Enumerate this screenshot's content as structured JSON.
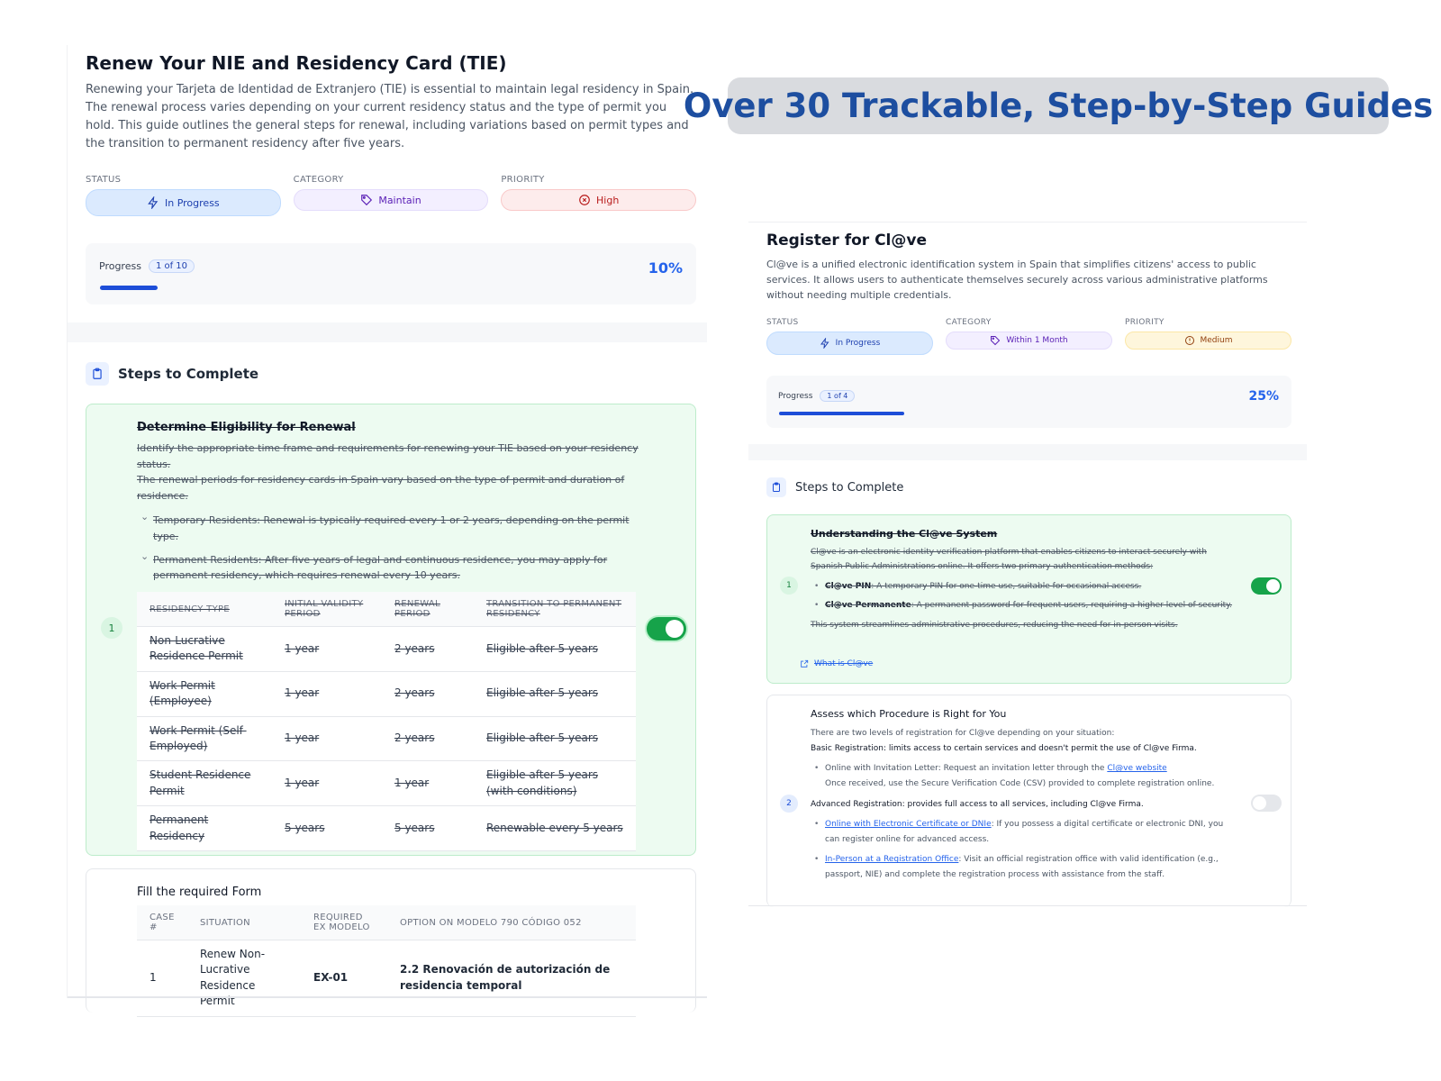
{
  "headline": "Over 30 Trackable, Step-by-Step Guides",
  "left": {
    "title": "Renew Your NIE and Residency Card (TIE)",
    "description": "Renewing your Tarjeta de Identidad de Extranjero (TIE) is essential to maintain legal residency in Spain. The renewal process varies depending on your current residency status and the type of permit you hold. This guide outlines the general steps for renewal, including variations based on permit types and the transition to permanent residency after five years.",
    "status_label": "STATUS",
    "status_value": "In Progress",
    "category_label": "CATEGORY",
    "category_value": "Maintain",
    "priority_label": "PRIORITY",
    "priority_value": "High",
    "progress_label": "Progress",
    "progress_count": "1 of 10",
    "progress_pct": "10%",
    "progress_fraction": 0.1,
    "steps_heading": "Steps to Complete",
    "step1": {
      "number": "1",
      "title": "Determine Eligibility for Renewal",
      "p1": "Identify the appropriate time frame and requirements for renewing your TIE based on your residency status.",
      "p2": "The renewal periods for residency cards in Spain vary based on the type of permit and duration of residence.",
      "b1": "Temporary Residents: Renewal is typically required every 1 or 2 years, depending on the permit type.",
      "b2": "Permanent Residents: After five years of legal and continuous residence, you may apply for permanent residency, which requires renewal every 10 years.",
      "completed": true,
      "table_headers": [
        "RESIDENCY TYPE",
        "INITIAL VALIDITY PERIOD",
        "RENEWAL PERIOD",
        "TRANSITION TO PERMANENT RESIDENCY"
      ],
      "table_rows": [
        [
          "Non-Lucrative Residence Permit",
          "1 year",
          "2 years",
          "Eligible after 5 years"
        ],
        [
          "Work Permit (Employee)",
          "1 year",
          "2 years",
          "Eligible after 5 years"
        ],
        [
          "Work Permit (Self-Employed)",
          "1 year",
          "2 years",
          "Eligible after 5 years"
        ],
        [
          "Student Residence Permit",
          "1 year",
          "1 year",
          "Eligible after 5 years (with conditions)"
        ],
        [
          "Permanent Residency",
          "5 years",
          "5 years",
          "Renewable every 5 years"
        ]
      ]
    },
    "step2": {
      "title": "Fill the required Form",
      "table_headers": [
        "CASE #",
        "SITUATION",
        "REQUIRED EX MODELO",
        "OPTION ON MODELO 790 CÓDIGO 052"
      ],
      "table_rows": [
        [
          "1",
          "Renew Non-Lucrative Residence Permit",
          "EX-01",
          "2.2 Renovación de autorización de residencia temporal"
        ]
      ]
    }
  },
  "right": {
    "title": "Register for Cl@ve",
    "description": "Cl@ve is a unified electronic identification system in Spain that simplifies citizens' access to public services. It allows users to authenticate themselves securely across various administrative platforms without needing multiple credentials.",
    "status_label": "STATUS",
    "status_value": "In Progress",
    "category_label": "CATEGORY",
    "category_value": "Within 1 Month",
    "priority_label": "PRIORITY",
    "priority_value": "Medium",
    "progress_label": "Progress",
    "progress_count": "1 of 4",
    "progress_pct": "25%",
    "progress_fraction": 0.25,
    "steps_heading": "Steps to Complete",
    "step1": {
      "number": "1",
      "title": "Understanding the Cl@ve System",
      "p1": "Cl@ve is an electronic identity verification platform that enables citizens to interact securely with Spanish Public Administrations online. It offers two primary authentication methods:",
      "b1_bold": "Cl@ve PIN",
      "b1_text": ": A temporary PIN for one-time use, suitable for occasional access.",
      "b2_bold": "Cl@ve Permanente",
      "b2_text": ": A permanent password for frequent users, requiring a higher level of security.",
      "p2": "This system streamlines administrative procedures, reducing the need for in-person visits.",
      "link": "What is Cl@ve",
      "completed": true
    },
    "step2": {
      "number": "2",
      "title": "Assess which Procedure is Right for You",
      "p1": "There are two levels of registration for Cl@ve depending on your situation:",
      "basic": "Basic Registration: limits access to certain services and doesn't permit the use of Cl@ve Firma.",
      "b1_text": "Online with Invitation Letter: Request an invitation letter through the ",
      "b1_link": "Cl@ve website",
      "b1_more": "Once received, use the Secure Verification Code (CSV) provided to complete registration online.",
      "advanced": "Advanced Registration: provides full access to all services, including Cl@ve Firma.",
      "b2_link": "Online with Electronic Certificate or DNIe",
      "b2_text": ": If you possess a digital certificate or electronic DNI, you can register online for advanced access.",
      "b3_link": "In-Person at a Registration Office",
      "b3_text": ": Visit an official registration office with valid identification (e.g., passport, NIE) and complete the registration process with assistance from the staff.",
      "completed": false
    }
  }
}
